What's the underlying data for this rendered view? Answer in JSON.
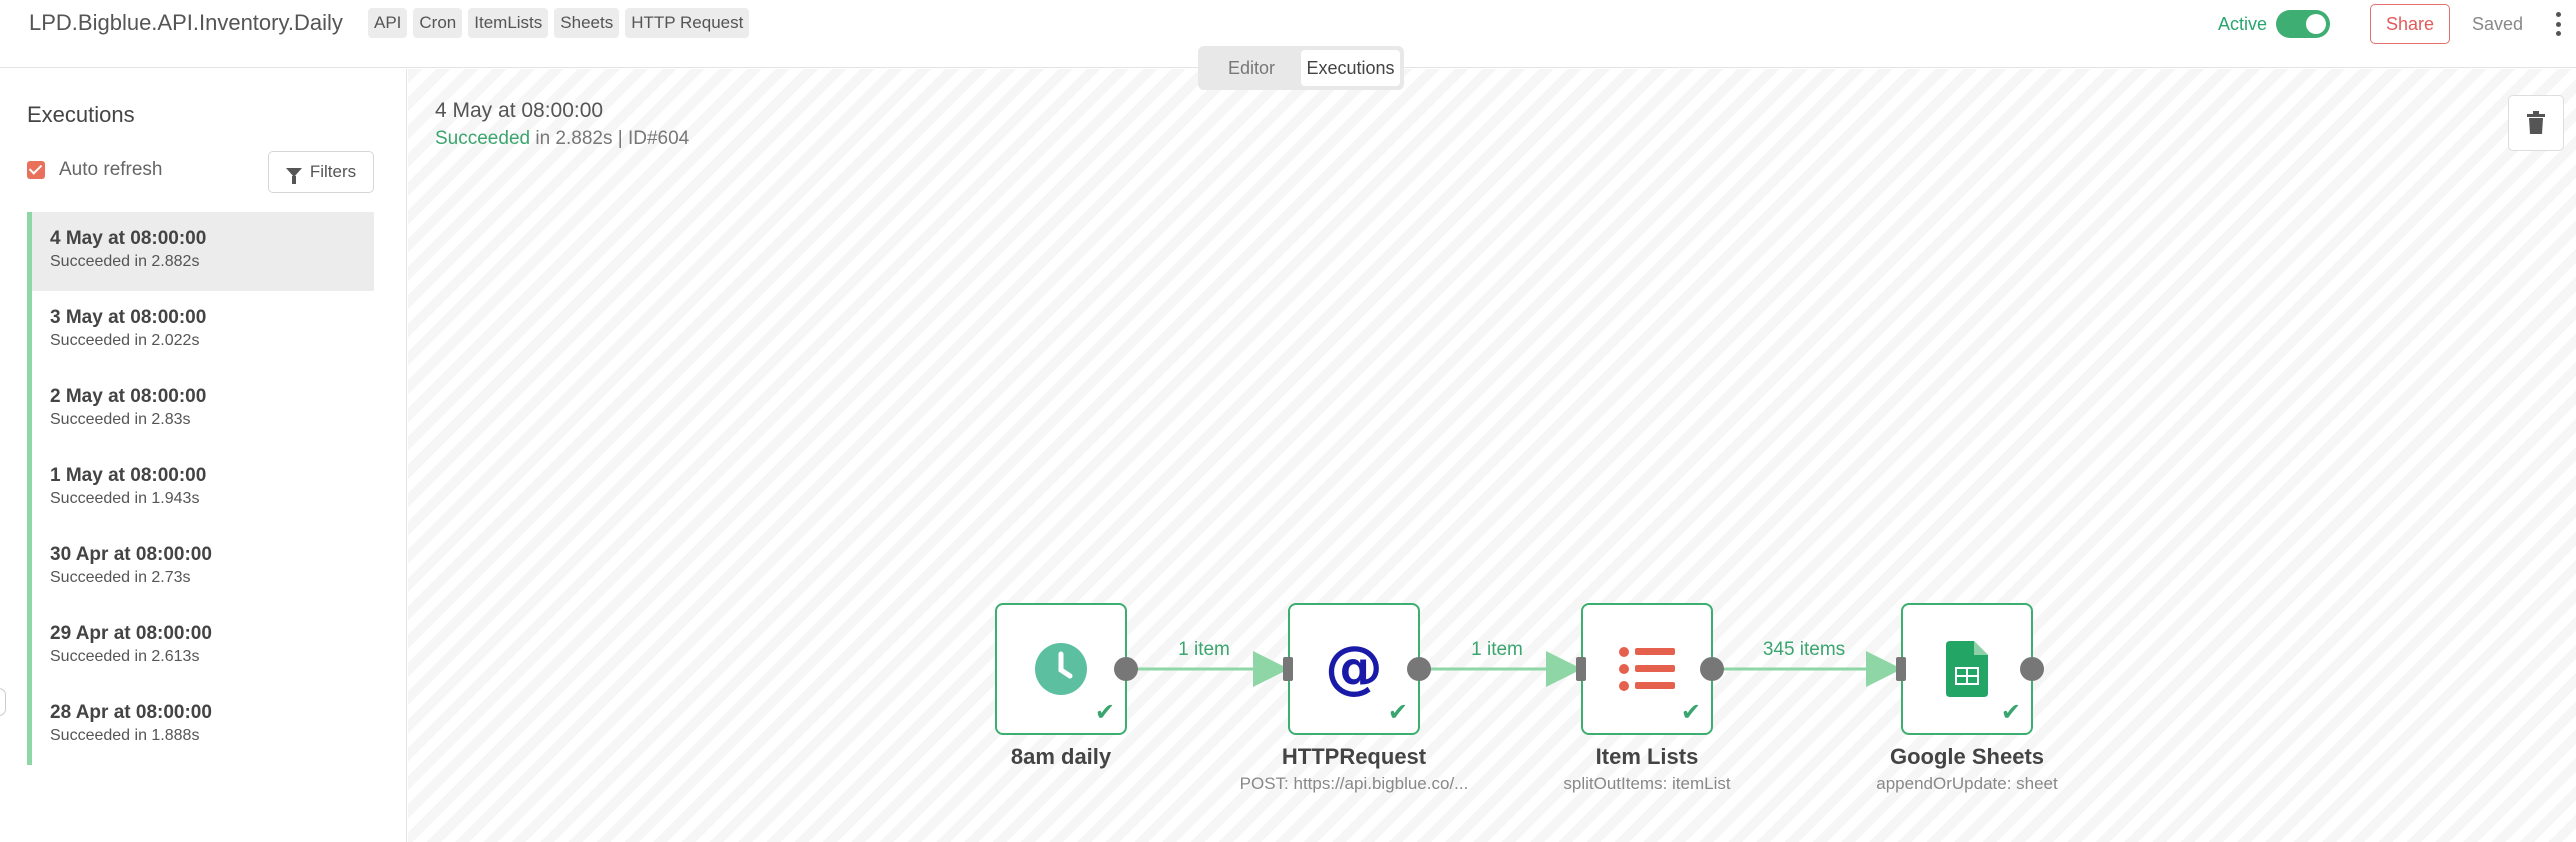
{
  "header": {
    "workflow_name": "LPD.Bigblue.API.Inventory.Daily",
    "tags": [
      "API",
      "Cron",
      "ItemLists",
      "Sheets",
      "HTTP Request"
    ],
    "active_label": "Active",
    "active": true,
    "share_label": "Share",
    "saved_label": "Saved"
  },
  "mode_tabs": [
    {
      "label": "Editor",
      "selected": false
    },
    {
      "label": "Executions",
      "selected": true
    }
  ],
  "sidebar": {
    "title": "Executions",
    "auto_refresh_label": "Auto refresh",
    "auto_refresh_checked": true,
    "filters_label": "Filters",
    "executions": [
      {
        "date": "4 May at 08:00:00",
        "status": "Succeeded in 2.882s",
        "selected": true
      },
      {
        "date": "3 May at 08:00:00",
        "status": "Succeeded in 2.022s",
        "selected": false
      },
      {
        "date": "2 May at 08:00:00",
        "status": "Succeeded in 2.83s",
        "selected": false
      },
      {
        "date": "1 May at 08:00:00",
        "status": "Succeeded in 1.943s",
        "selected": false
      },
      {
        "date": "30 Apr at 08:00:00",
        "status": "Succeeded in 2.73s",
        "selected": false
      },
      {
        "date": "29 Apr at 08:00:00",
        "status": "Succeeded in 2.613s",
        "selected": false
      },
      {
        "date": "28 Apr at 08:00:00",
        "status": "Succeeded in 1.888s",
        "selected": false
      }
    ]
  },
  "execution_detail": {
    "date": "4 May at 08:00:00",
    "status_word": "Succeeded",
    "status_rest": " in 2.882s | ID#604"
  },
  "workflow": {
    "nodes": [
      {
        "title": "8am daily",
        "subtitle": "",
        "icon": "clock-icon"
      },
      {
        "title": "HTTPRequest",
        "subtitle": "POST: https://api.bigblue.co/...",
        "icon": "at-sign-icon"
      },
      {
        "title": "Item Lists",
        "subtitle": "splitOutItems: itemList",
        "icon": "list-icon"
      },
      {
        "title": "Google Sheets",
        "subtitle": "appendOrUpdate: sheet",
        "icon": "google-sheets-icon"
      }
    ],
    "connections": [
      {
        "label": "1 item"
      },
      {
        "label": "1 item"
      },
      {
        "label": "345 items"
      }
    ]
  },
  "colors": {
    "success": "#3aa56e",
    "accent": "#e25a5a",
    "clock": "#5cc0a0",
    "at_sign": "#1a1aa8",
    "list": "#e5604d",
    "sheets": "#23a566"
  }
}
